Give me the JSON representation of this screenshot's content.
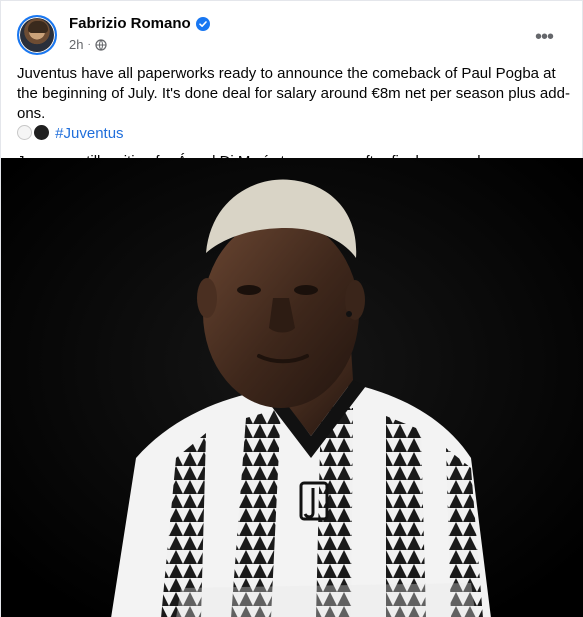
{
  "post": {
    "author": "Fabrizio Romano",
    "time": "2h",
    "separator": "·",
    "more_label": "•••",
    "text_line1": "Juventus have all paperworks ready to announce the comeback of Paul Pogba at the beginning of July. It's done deal for salary around €8m net per season plus add-ons.",
    "hashtag": "#Juventus",
    "text_line2": "Juve are still waiting for Ángel Di María to answers after final proposal."
  },
  "colors": {
    "link": "#216fdb",
    "verified": "#1877f2",
    "meta": "#65676b",
    "photo_bg": "#000000"
  },
  "icons": {
    "verified": "verified-badge-icon",
    "audience": "globe-icon",
    "more": "more-options-icon",
    "emoji_white": "white-circle-emoji",
    "emoji_black": "black-circle-emoji"
  }
}
